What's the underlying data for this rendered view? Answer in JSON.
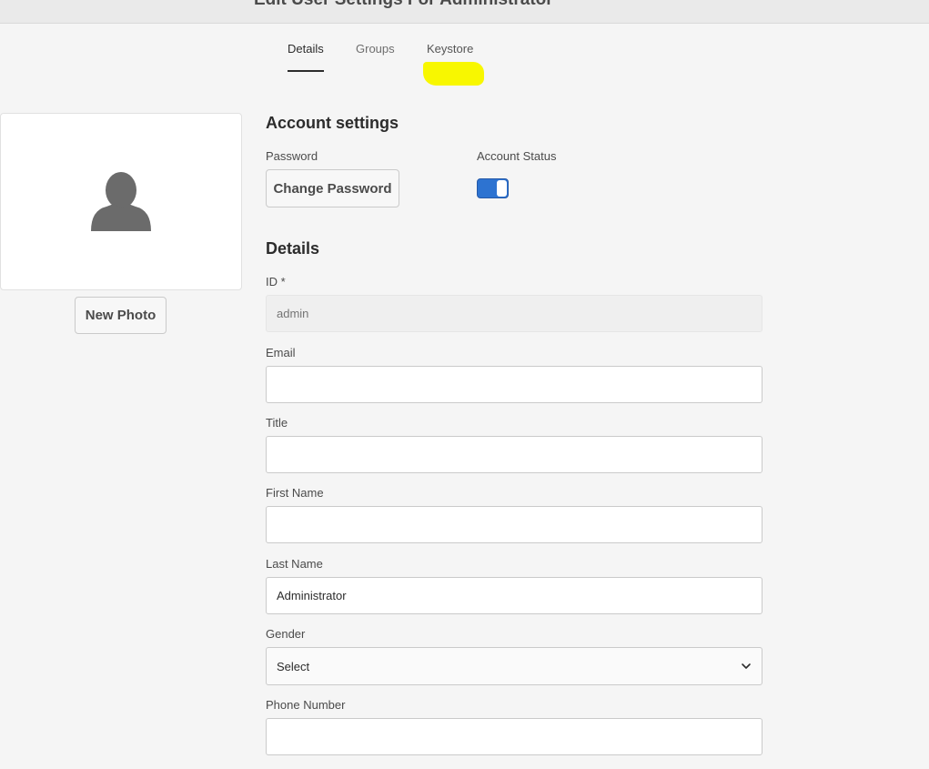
{
  "header": {
    "title": "Edit User Settings For Administrator"
  },
  "tabs": [
    {
      "label": "Details",
      "active": true
    },
    {
      "label": "Groups",
      "active": false
    },
    {
      "label": "Keystore",
      "active": false,
      "highlight_color": "#f8f700"
    }
  ],
  "photo": {
    "icon": "user-silhouette-icon",
    "new_photo_label": "New Photo"
  },
  "account_settings": {
    "heading": "Account settings",
    "password_label": "Password",
    "change_password_label": "Change Password",
    "account_status_label": "Account Status",
    "account_status_enabled": true,
    "toggle_color": "#2d73d1"
  },
  "details": {
    "heading": "Details",
    "id": {
      "label": "ID *",
      "placeholder": "admin",
      "value": ""
    },
    "email": {
      "label": "Email",
      "value": ""
    },
    "title": {
      "label": "Title",
      "value": ""
    },
    "first_name": {
      "label": "First Name",
      "value": ""
    },
    "last_name": {
      "label": "Last Name",
      "value": "Administrator"
    },
    "gender": {
      "label": "Gender",
      "selected": "Select",
      "icon": "chevron-down-icon"
    },
    "phone": {
      "label": "Phone Number",
      "value": ""
    }
  }
}
